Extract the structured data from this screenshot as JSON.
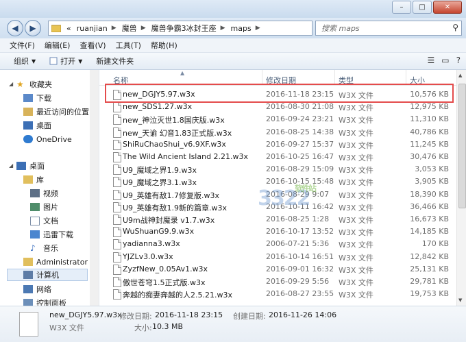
{
  "nav": {
    "back": "◀",
    "forward": "▶",
    "breadcrumb": [
      "«",
      "ruanjian",
      "魔兽",
      "魔兽争霸3冰封王座",
      "maps"
    ],
    "search_placeholder": "搜索 maps"
  },
  "menu": [
    "文件(F)",
    "编辑(E)",
    "查看(V)",
    "工具(T)",
    "帮助(H)"
  ],
  "toolbar": {
    "organize": "组织",
    "open": "打开",
    "new_folder": "新建文件夹"
  },
  "sidebar": {
    "favorites": {
      "label": "收藏夹",
      "items": [
        "下载",
        "最近访问的位置",
        "桌面",
        "OneDrive"
      ]
    },
    "desktop": {
      "label": "桌面"
    },
    "library": {
      "label": "库",
      "items": [
        "视频",
        "图片",
        "文档",
        "迅雷下载",
        "音乐"
      ]
    },
    "other": [
      "Administrator",
      "计算机",
      "网络",
      "控制面板"
    ]
  },
  "columns": {
    "name": "名称",
    "date": "修改日期",
    "type": "类型",
    "size": "大小"
  },
  "files": [
    {
      "name": "new_DGJY5.97.w3x",
      "date": "2016-11-18 23:15",
      "type": "W3X 文件",
      "size": "10,576 KB"
    },
    {
      "name": "new_SDS1.27.w3x",
      "date": "2016-08-30 21:08",
      "type": "W3X 文件",
      "size": "12,975 KB"
    },
    {
      "name": "new_神泣灭世1.8国庆版.w3x",
      "date": "2016-09-24 23:21",
      "type": "W3X 文件",
      "size": "11,310 KB"
    },
    {
      "name": "new_天谕 幻音1.83正式版.w3x",
      "date": "2016-08-25 14:38",
      "type": "W3X 文件",
      "size": "40,786 KB"
    },
    {
      "name": "ShiRuChaoShui_v6.9XF.w3x",
      "date": "2016-09-27 15:37",
      "type": "W3X 文件",
      "size": "11,245 KB"
    },
    {
      "name": "The Wild Ancient Island 2.21.w3x",
      "date": "2016-10-25 16:47",
      "type": "W3X 文件",
      "size": "30,476 KB"
    },
    {
      "name": "U9_魔域之界1.9.w3x",
      "date": "2016-08-29 15:09",
      "type": "W3X 文件",
      "size": "3,053 KB"
    },
    {
      "name": "U9_魔域之界3.1.w3x",
      "date": "2016-10-15 15:48",
      "type": "W3X 文件",
      "size": "3,905 KB"
    },
    {
      "name": "U9_英雄有敌1.7修复版.w3x",
      "date": "2016-08-29 9:07",
      "type": "W3X 文件",
      "size": "18,390 KB"
    },
    {
      "name": "U9_英雄有敌1.9新的篇章.w3x",
      "date": "2016-10-11 16:42",
      "type": "W3X 文件",
      "size": "36,466 KB"
    },
    {
      "name": "U9m战神封魔录 v1.7.w3x",
      "date": "2016-08-25 1:28",
      "type": "W3X 文件",
      "size": "16,673 KB"
    },
    {
      "name": "WuShuanG9.9.w3x",
      "date": "2016-10-17 13:52",
      "type": "W3X 文件",
      "size": "14,185 KB"
    },
    {
      "name": "yadianna3.w3x",
      "date": "2006-07-21 5:36",
      "type": "W3X 文件",
      "size": "170 KB"
    },
    {
      "name": "YJZLv3.0.w3x",
      "date": "2016-10-14 16:51",
      "type": "W3X 文件",
      "size": "12,842 KB"
    },
    {
      "name": "ZyzfNew_0.05Av1.w3x",
      "date": "2016-09-01 16:32",
      "type": "W3X 文件",
      "size": "25,131 KB"
    },
    {
      "name": "傲世苍穹1.5正式版.w3x",
      "date": "2016-09-29 5:56",
      "type": "W3X 文件",
      "size": "29,781 KB"
    },
    {
      "name": "奔越的痴妻奔越的人2.5.21.w3x",
      "date": "2016-08-27 23:55",
      "type": "W3X 文件",
      "size": "19,753 KB"
    }
  ],
  "status": {
    "name": "new_DGJY5.97.w3x",
    "modified_label": "修改日期:",
    "modified": "2016-11-18 23:15",
    "created_label": "创建日期:",
    "created": "2016-11-26 14:06",
    "type": "W3X 文件",
    "size_label": "大小:",
    "size": "10.3 MB"
  },
  "watermark": {
    "big": "3322",
    "small": "软件站"
  }
}
